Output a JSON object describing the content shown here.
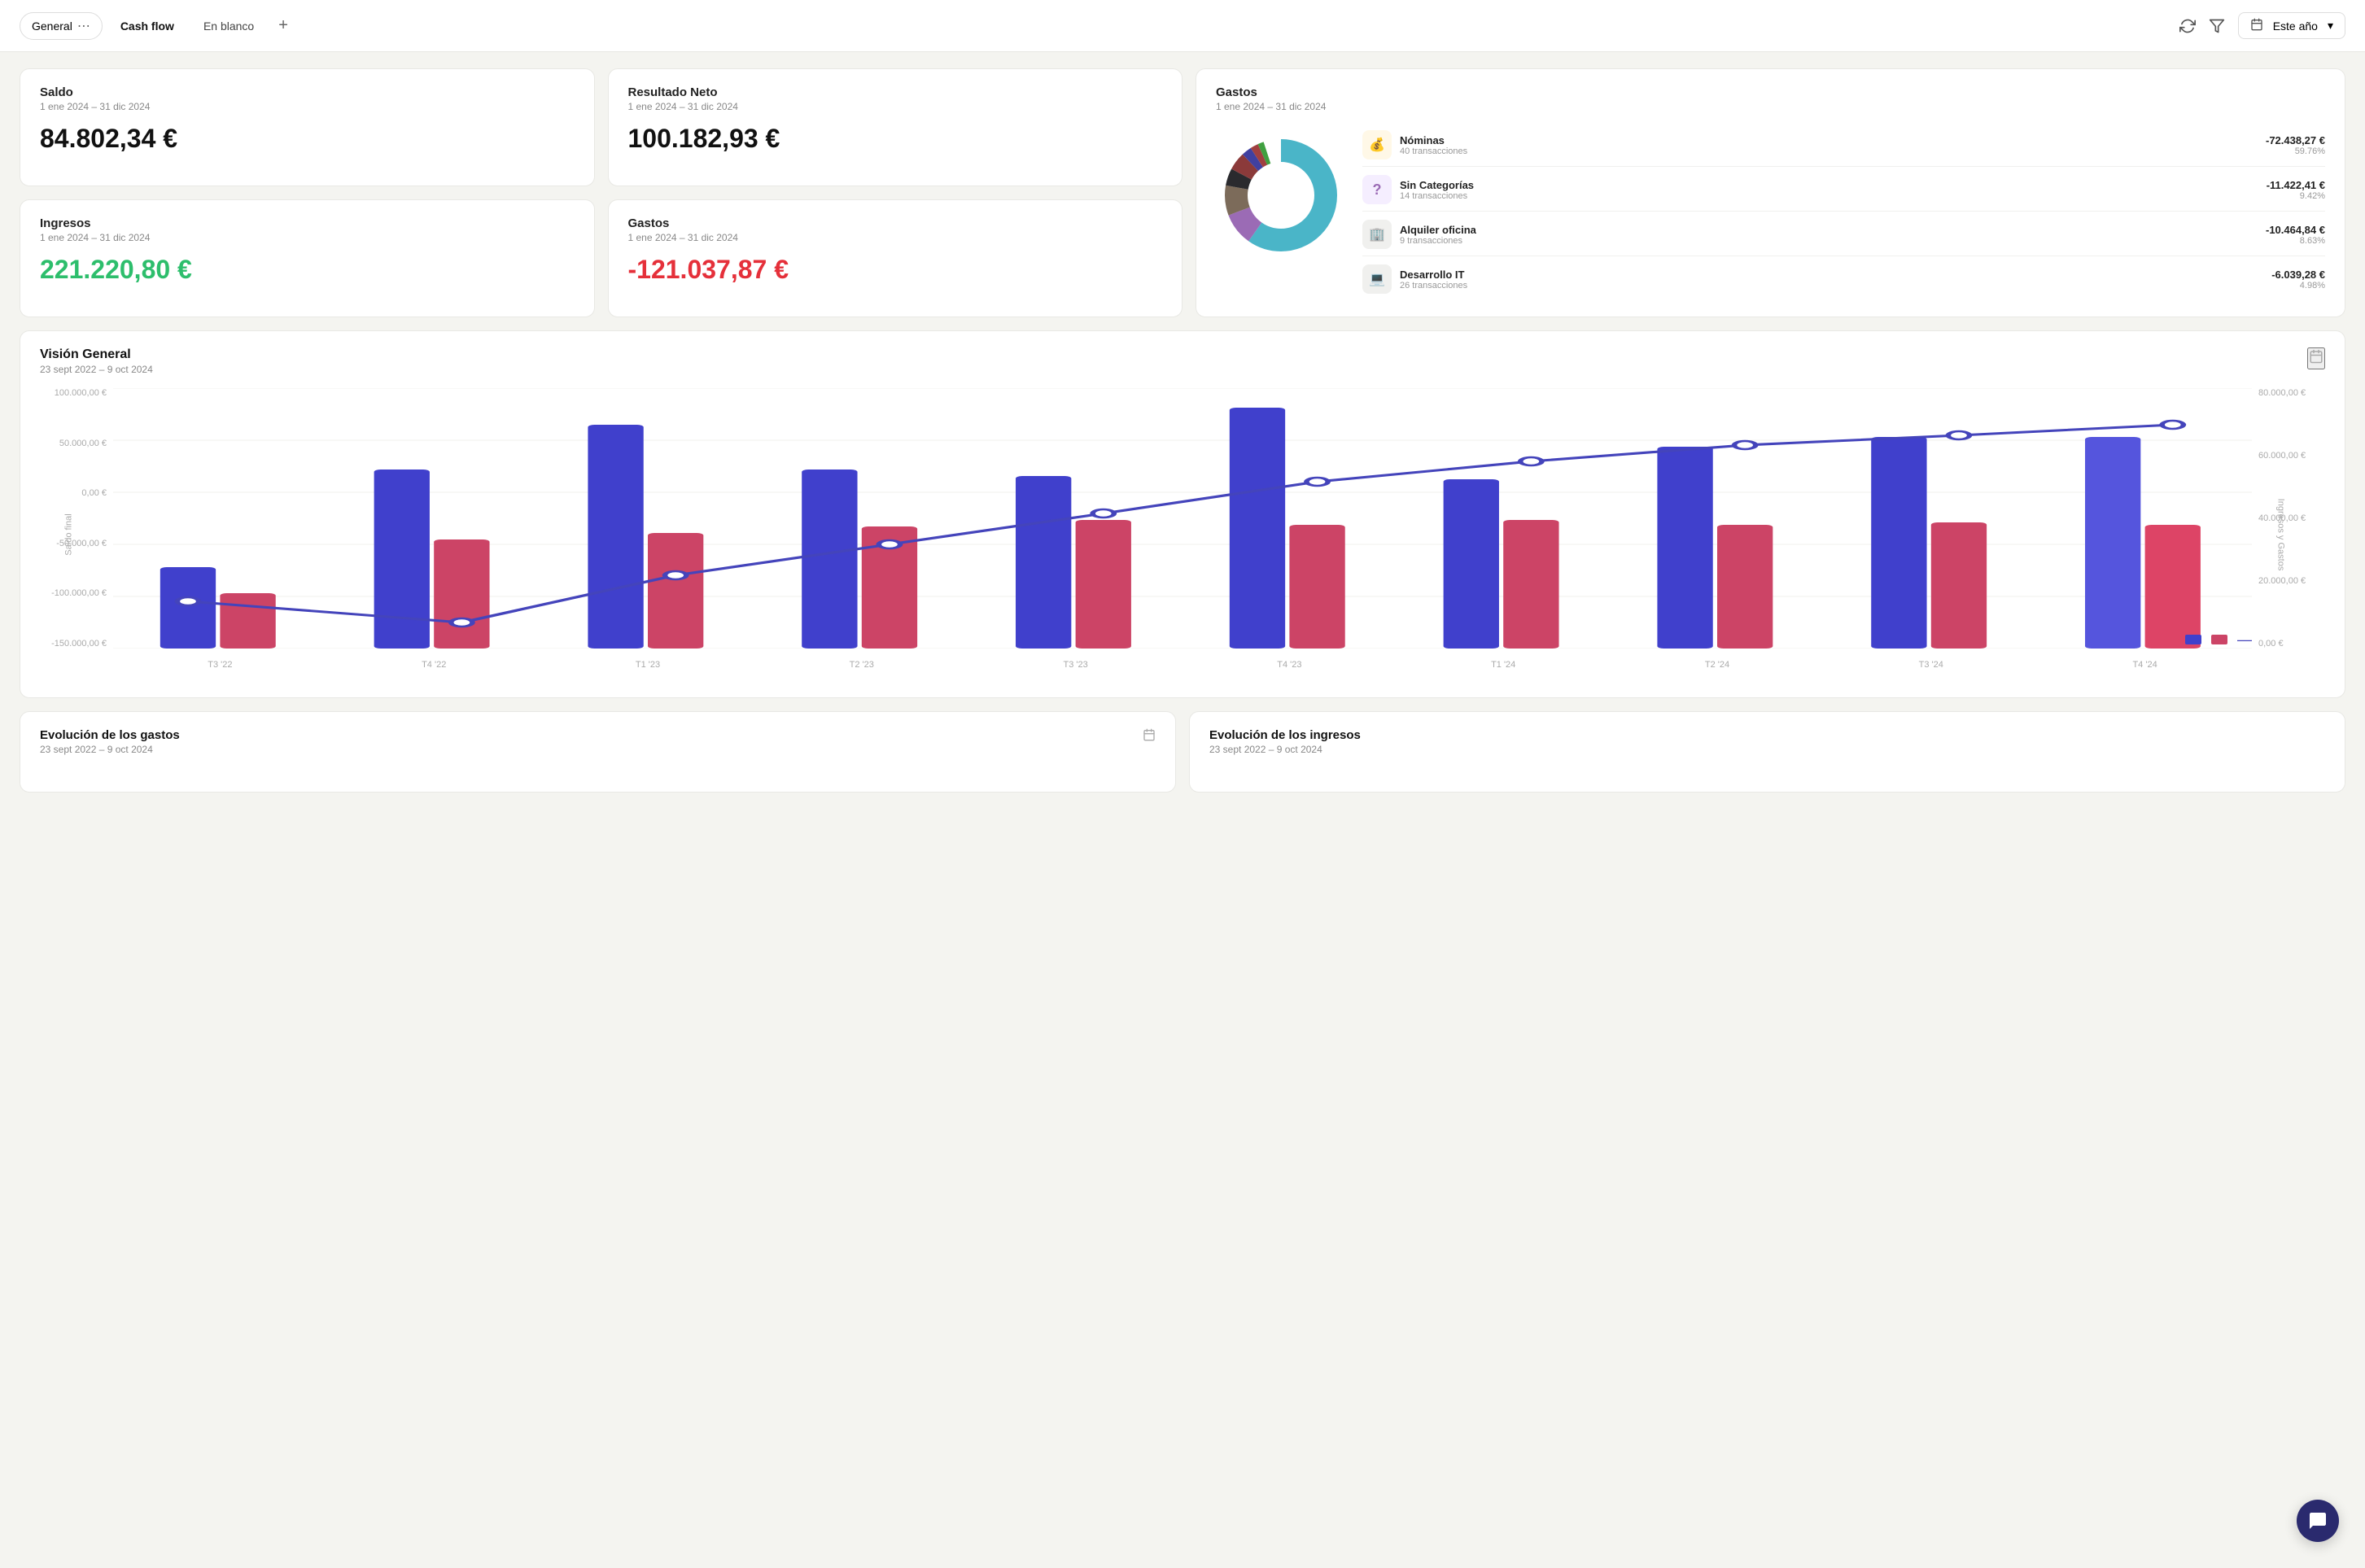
{
  "nav": {
    "tab_general": "General",
    "tab_general_dots": "⋯",
    "tab_cashflow": "Cash flow",
    "tab_enblanco": "En blanco",
    "tab_add": "+",
    "date_label": "Este año",
    "refresh_icon": "↻",
    "filter_icon": "⧟",
    "calendar_icon": "📅"
  },
  "saldo": {
    "title": "Saldo",
    "date": "1 ene 2024 – 31 dic 2024",
    "value": "84.802,34 €"
  },
  "resultado": {
    "title": "Resultado Neto",
    "date": "1 ene 2024 – 31 dic 2024",
    "value": "100.182,93 €"
  },
  "ingresos": {
    "title": "Ingresos",
    "date": "1 ene 2024 – 31 dic 2024",
    "value": "221.220,80 €"
  },
  "gastos_card": {
    "title": "Gastos",
    "date": "1 ene 2024 – 31 dic 2024",
    "value": "-121.037,87 €"
  },
  "gastos_panel": {
    "title": "Gastos",
    "date": "1 ene 2024 – 31 dic 2024",
    "items": [
      {
        "name": "Nóminas",
        "transactions": "40 transacciones",
        "amount": "-72.438,27 €",
        "pct": "59.76%",
        "icon": "💰",
        "color": "#4ab5c8"
      },
      {
        "name": "Sin Categorías",
        "transactions": "14 transacciones",
        "amount": "-11.422,41 €",
        "pct": "9.42%",
        "icon": "❓",
        "color": "#9b6bb5"
      },
      {
        "name": "Alquiler oficina",
        "transactions": "9 transacciones",
        "amount": "-10.464,84 €",
        "pct": "8.63%",
        "icon": "🏢",
        "color": "#7c6b5a"
      },
      {
        "name": "Desarrollo IT",
        "transactions": "26 transacciones",
        "amount": "-6.039,28 €",
        "pct": "4.98%",
        "icon": "💻",
        "color": "#2a2a6e"
      }
    ]
  },
  "vision_general": {
    "title": "Visión General",
    "date": "23 sept 2022 – 9 oct 2024",
    "y_left_title": "Saldo final",
    "y_right_title": "Ingresos y Gastos",
    "y_left_labels": [
      "100.000,00 €",
      "50.000,00 €",
      "0,00 €",
      "-50.000,00 €",
      "-100.000,00 €",
      "-150.000,00 €"
    ],
    "y_right_labels": [
      "80.000,00 €",
      "60.000,00 €",
      "40.000,00 €",
      "20.000,00 €",
      "0,00 €"
    ],
    "x_labels": [
      "T3 '22",
      "T4 '22",
      "T1 '23",
      "T2 '23",
      "T3 '23",
      "T4 '23",
      "T1 '24",
      "T2 '24",
      "T3 '24",
      "T4 '24"
    ],
    "legend_income_label": "",
    "legend_expense_label": "",
    "legend_balance_label": ""
  },
  "evolucion_gastos": {
    "title": "Evolución de los gastos",
    "date": "23 sept 2022 – 9 oct 2024"
  },
  "evolucion_ingresos": {
    "title": "Evolución de los ingresos",
    "date": "23 sept 2022 – 9 oct 2024"
  }
}
